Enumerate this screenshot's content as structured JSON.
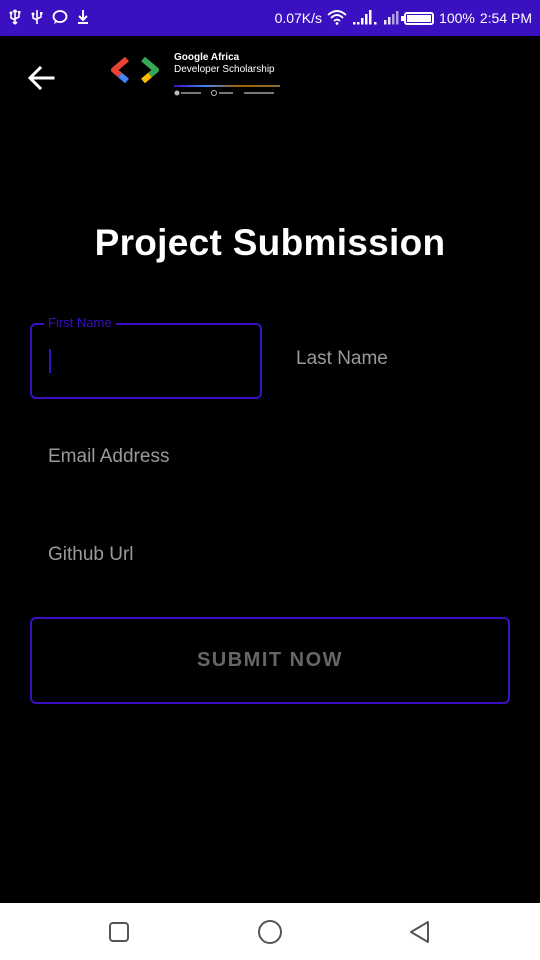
{
  "status_bar": {
    "network_speed": "0.07K/s",
    "battery_percent": "100%",
    "time": "2:54 PM"
  },
  "header": {
    "logo_line1": "Google Africa",
    "logo_line2": "Developer Scholarship"
  },
  "page_title": "Project Submission",
  "form": {
    "first_name_label": "First Name",
    "first_name_value": "",
    "last_name_placeholder": "Last Name",
    "email_placeholder": "Email Address",
    "github_placeholder": "Github Url"
  },
  "submit_label": "SUBMIT NOW",
  "colors": {
    "accent": "#3a10c0",
    "background": "#000000",
    "placeholder": "#9a9a9a",
    "nav_bar": "#ffffff"
  },
  "icons": [
    "usb-icon",
    "chat-bubble-icon",
    "download-icon",
    "wifi-icon",
    "signal-icon",
    "battery-icon",
    "back-arrow-icon",
    "recent-apps-icon",
    "home-icon",
    "back-triangle-icon"
  ]
}
